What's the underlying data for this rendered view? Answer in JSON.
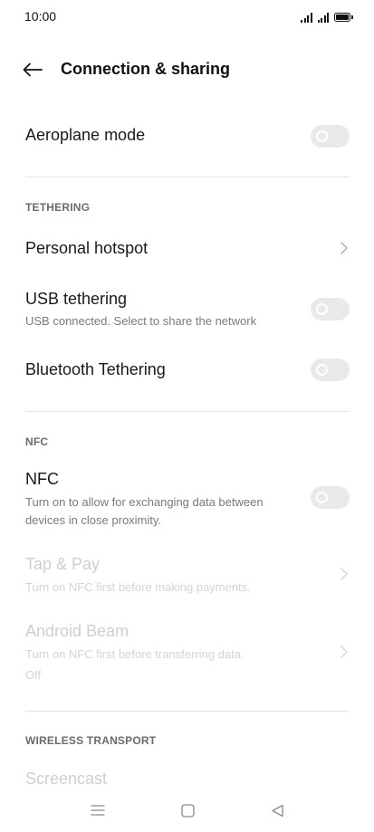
{
  "status_bar": {
    "time": "10:00"
  },
  "header": {
    "title": "Connection & sharing"
  },
  "items": {
    "aeroplane": {
      "title": "Aeroplane mode",
      "enabled": false
    },
    "hotspot": {
      "title": "Personal hotspot"
    },
    "usb": {
      "title": "USB tethering",
      "subtitle": "USB connected. Select to share the network",
      "enabled": false
    },
    "bluetooth": {
      "title": "Bluetooth Tethering",
      "enabled": false
    },
    "nfc": {
      "title": "NFC",
      "subtitle": "Turn on to allow for exchanging data between devices in close proximity.",
      "enabled": false
    },
    "tap_pay": {
      "title": "Tap & Pay",
      "subtitle": "Turn on NFC first before making payments."
    },
    "android_beam": {
      "title": "Android Beam",
      "subtitle": "Turn on NFC first before transferring data.",
      "status": "Off"
    },
    "screencast": {
      "title": "Screencast"
    }
  },
  "sections": {
    "tethering": "TETHERING",
    "nfc": "NFC",
    "wireless": "WIRELESS TRANSPORT"
  },
  "icons": {
    "back": "arrow-left-icon",
    "chevron": "chevron-right-icon",
    "nav_menu": "menu-icon",
    "nav_home": "home-square-icon",
    "nav_back": "back-triangle-icon"
  }
}
